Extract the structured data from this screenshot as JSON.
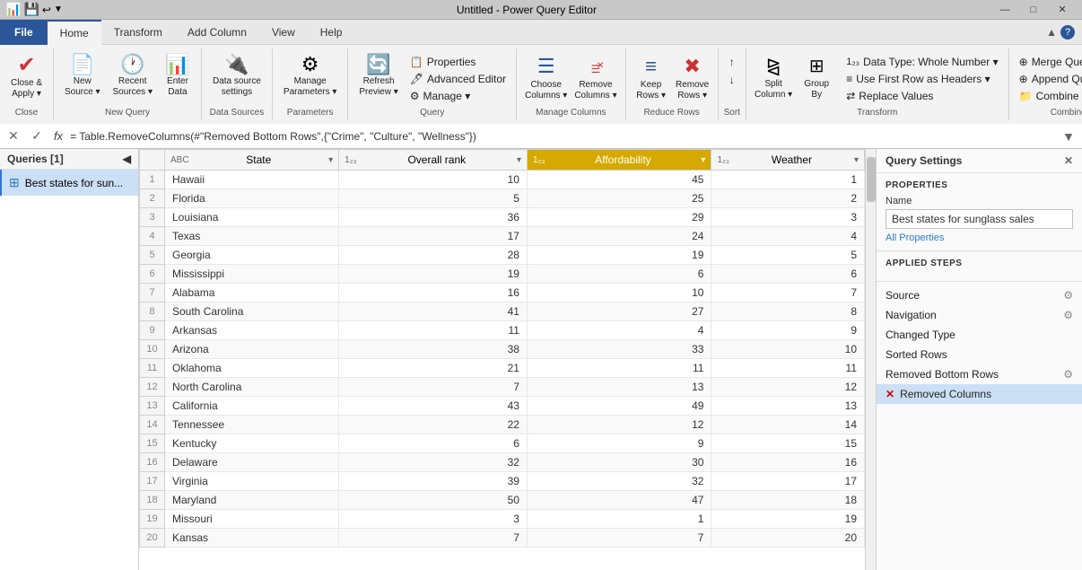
{
  "titleBar": {
    "title": "Untitled - Power Query Editor",
    "minimize": "—",
    "restore": "□",
    "close": "✕"
  },
  "tabs": {
    "file": "File",
    "home": "Home",
    "transform": "Transform",
    "addColumn": "Add Column",
    "view": "View",
    "help": "Help"
  },
  "ribbon": {
    "close": {
      "label": "Close &\nApply",
      "icon": "✔"
    },
    "newSource": {
      "label": "New\nSource",
      "icon": "📄"
    },
    "recentSources": {
      "label": "Recent\nSources",
      "icon": "🕐"
    },
    "enterData": {
      "label": "Enter\nData",
      "icon": "📊"
    },
    "dataSourceSettings": {
      "label": "Data source\nsettings",
      "icon": "🔌"
    },
    "manageParameters": {
      "label": "Manage\nParameters",
      "icon": "⚙"
    },
    "refreshPreview": {
      "label": "Refresh\nPreview",
      "icon": "🔄"
    },
    "properties": {
      "label": "Properties",
      "icon": "📋"
    },
    "advancedEditor": {
      "label": "Advanced Editor",
      "icon": "🖊"
    },
    "manage": {
      "label": "Manage",
      "icon": "⚙"
    },
    "chooseColumns": {
      "label": "Choose\nColumns",
      "icon": "☰"
    },
    "removeColumns": {
      "label": "Remove\nColumns",
      "icon": "✖"
    },
    "keepRows": {
      "label": "Keep\nRows",
      "icon": "≡"
    },
    "removeRows": {
      "label": "Remove\nRows",
      "icon": "✖"
    },
    "splitColumn": {
      "label": "Split\nColumn",
      "icon": "⧎"
    },
    "groupBy": {
      "label": "Group\nBy",
      "icon": "⊞"
    },
    "dataType": {
      "label": "Data Type: Whole Number",
      "icon": "123"
    },
    "useFirstRow": {
      "label": "Use First Row as Headers",
      "icon": "▼"
    },
    "replaceValues": {
      "label": "Replace Values",
      "icon": "⇄"
    },
    "mergeQueries": {
      "label": "Merge Queries",
      "icon": "⊕"
    },
    "appendQueries": {
      "label": "Append Queries",
      "icon": "⊕"
    },
    "combineFiles": {
      "label": "Combine Files",
      "icon": "📁"
    },
    "groups": {
      "close": "Close",
      "newQuery": "New Query",
      "dataSources": "Data Sources",
      "parameters": "Parameters",
      "query": "Query",
      "manageColumns": "Manage Columns",
      "reduceRows": "Reduce Rows",
      "sort": "Sort",
      "transform": "Transform",
      "combine": "Combine"
    }
  },
  "formulaBar": {
    "formula": "= Table.RemoveColumns(#\"Removed Bottom Rows\",{\"Crime\", \"Culture\", \"Wellness\"})"
  },
  "queriesPanel": {
    "header": "Queries [1]",
    "items": [
      {
        "name": "Best states for sun..."
      }
    ]
  },
  "table": {
    "columns": [
      {
        "id": "state",
        "label": "State",
        "type": "ABC",
        "highlighted": false
      },
      {
        "id": "overallRank",
        "label": "Overall rank",
        "type": "123",
        "highlighted": false
      },
      {
        "id": "affordability",
        "label": "Affordability",
        "type": "123",
        "highlighted": true
      },
      {
        "id": "weather",
        "label": "Weather",
        "type": "123",
        "highlighted": false
      }
    ],
    "rows": [
      {
        "num": 1,
        "state": "Hawaii",
        "overallRank": 10,
        "affordability": 45,
        "weather": 1
      },
      {
        "num": 2,
        "state": "Florida",
        "overallRank": 5,
        "affordability": 25,
        "weather": 2
      },
      {
        "num": 3,
        "state": "Louisiana",
        "overallRank": 36,
        "affordability": 29,
        "weather": 3
      },
      {
        "num": 4,
        "state": "Texas",
        "overallRank": 17,
        "affordability": 24,
        "weather": 4
      },
      {
        "num": 5,
        "state": "Georgia",
        "overallRank": 28,
        "affordability": 19,
        "weather": 5
      },
      {
        "num": 6,
        "state": "Mississippi",
        "overallRank": 19,
        "affordability": 6,
        "weather": 6
      },
      {
        "num": 7,
        "state": "Alabama",
        "overallRank": 16,
        "affordability": 10,
        "weather": 7
      },
      {
        "num": 8,
        "state": "South Carolina",
        "overallRank": 41,
        "affordability": 27,
        "weather": 8
      },
      {
        "num": 9,
        "state": "Arkansas",
        "overallRank": 11,
        "affordability": 4,
        "weather": 9
      },
      {
        "num": 10,
        "state": "Arizona",
        "overallRank": 38,
        "affordability": 33,
        "weather": 10
      },
      {
        "num": 11,
        "state": "Oklahoma",
        "overallRank": 21,
        "affordability": 11,
        "weather": 11
      },
      {
        "num": 12,
        "state": "North Carolina",
        "overallRank": 7,
        "affordability": 13,
        "weather": 12
      },
      {
        "num": 13,
        "state": "California",
        "overallRank": 43,
        "affordability": 49,
        "weather": 13
      },
      {
        "num": 14,
        "state": "Tennessee",
        "overallRank": 22,
        "affordability": 12,
        "weather": 14
      },
      {
        "num": 15,
        "state": "Kentucky",
        "overallRank": 6,
        "affordability": 9,
        "weather": 15
      },
      {
        "num": 16,
        "state": "Delaware",
        "overallRank": 32,
        "affordability": 30,
        "weather": 16
      },
      {
        "num": 17,
        "state": "Virginia",
        "overallRank": 39,
        "affordability": 32,
        "weather": 17
      },
      {
        "num": 18,
        "state": "Maryland",
        "overallRank": 50,
        "affordability": 47,
        "weather": 18
      },
      {
        "num": 19,
        "state": "Missouri",
        "overallRank": 3,
        "affordability": 1,
        "weather": 19
      },
      {
        "num": 20,
        "state": "Kansas",
        "overallRank": 7,
        "affordability": 7,
        "weather": 20
      }
    ]
  },
  "settings": {
    "header": "Query Settings",
    "propertiesLabel": "PROPERTIES",
    "nameLabel": "Name",
    "nameValue": "Best states for sunglass sales",
    "allPropertiesLink": "All Properties",
    "appliedStepsLabel": "APPLIED STEPS",
    "steps": [
      {
        "name": "Source",
        "hasGear": true,
        "active": false,
        "hasX": false
      },
      {
        "name": "Navigation",
        "hasGear": true,
        "active": false,
        "hasX": false
      },
      {
        "name": "Changed Type",
        "hasGear": false,
        "active": false,
        "hasX": false
      },
      {
        "name": "Sorted Rows",
        "hasGear": false,
        "active": false,
        "hasX": false
      },
      {
        "name": "Removed Bottom Rows",
        "hasGear": true,
        "active": false,
        "hasX": false
      },
      {
        "name": "Removed Columns",
        "hasGear": false,
        "active": true,
        "hasX": true
      }
    ]
  }
}
